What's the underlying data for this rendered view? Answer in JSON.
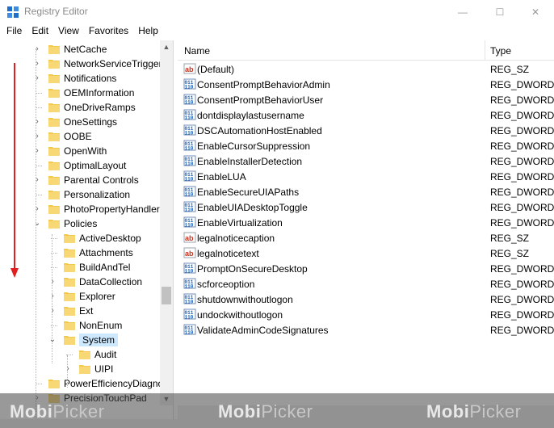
{
  "window": {
    "title": "Registry Editor",
    "min_glyph": "—",
    "max_glyph": "☐",
    "close_glyph": "✕"
  },
  "menu": [
    "File",
    "Edit",
    "View",
    "Favorites",
    "Help"
  ],
  "tree": {
    "items": [
      {
        "label": "NetCache",
        "expandable": true,
        "expanded": false
      },
      {
        "label": "NetworkServiceTriggers",
        "expandable": true,
        "expanded": false
      },
      {
        "label": "Notifications",
        "expandable": true,
        "expanded": false
      },
      {
        "label": "OEMInformation",
        "expandable": false,
        "expanded": false
      },
      {
        "label": "OneDriveRamps",
        "expandable": false,
        "expanded": false
      },
      {
        "label": "OneSettings",
        "expandable": true,
        "expanded": false
      },
      {
        "label": "OOBE",
        "expandable": true,
        "expanded": false
      },
      {
        "label": "OpenWith",
        "expandable": true,
        "expanded": false
      },
      {
        "label": "OptimalLayout",
        "expandable": false,
        "expanded": false
      },
      {
        "label": "Parental Controls",
        "expandable": true,
        "expanded": false
      },
      {
        "label": "Personalization",
        "expandable": false,
        "expanded": false
      },
      {
        "label": "PhotoPropertyHandler",
        "expandable": true,
        "expanded": false
      },
      {
        "label": "Policies",
        "expandable": true,
        "expanded": true
      },
      {
        "label": "ActiveDesktop",
        "expandable": false,
        "expanded": false
      },
      {
        "label": "Attachments",
        "expandable": false,
        "expanded": false
      },
      {
        "label": "BuildAndTel",
        "expandable": false,
        "expanded": false
      },
      {
        "label": "DataCollection",
        "expandable": true,
        "expanded": false
      },
      {
        "label": "Explorer",
        "expandable": true,
        "expanded": false
      },
      {
        "label": "Ext",
        "expandable": true,
        "expanded": false
      },
      {
        "label": "NonEnum",
        "expandable": false,
        "expanded": false
      },
      {
        "label": "System",
        "expandable": true,
        "expanded": true,
        "selected": true
      },
      {
        "label": "Audit",
        "expandable": false,
        "expanded": false
      },
      {
        "label": "UIPI",
        "expandable": true,
        "expanded": false
      },
      {
        "label": "PowerEfficiencyDiagnostics",
        "expandable": false,
        "expanded": false
      },
      {
        "label": "PrecisionTouchPad",
        "expandable": true,
        "expanded": false
      }
    ]
  },
  "list": {
    "columns": {
      "name": "Name",
      "type": "Type"
    },
    "rows": [
      {
        "name": "(Default)",
        "type": "REG_SZ",
        "icon": "string-value-icon"
      },
      {
        "name": "ConsentPromptBehaviorAdmin",
        "type": "REG_DWORD",
        "icon": "binary-value-icon"
      },
      {
        "name": "ConsentPromptBehaviorUser",
        "type": "REG_DWORD",
        "icon": "binary-value-icon"
      },
      {
        "name": "dontdisplaylastusername",
        "type": "REG_DWORD",
        "icon": "binary-value-icon"
      },
      {
        "name": "DSCAutomationHostEnabled",
        "type": "REG_DWORD",
        "icon": "binary-value-icon"
      },
      {
        "name": "EnableCursorSuppression",
        "type": "REG_DWORD",
        "icon": "binary-value-icon"
      },
      {
        "name": "EnableInstallerDetection",
        "type": "REG_DWORD",
        "icon": "binary-value-icon"
      },
      {
        "name": "EnableLUA",
        "type": "REG_DWORD",
        "icon": "binary-value-icon"
      },
      {
        "name": "EnableSecureUIAPaths",
        "type": "REG_DWORD",
        "icon": "binary-value-icon"
      },
      {
        "name": "EnableUIADesktopToggle",
        "type": "REG_DWORD",
        "icon": "binary-value-icon"
      },
      {
        "name": "EnableVirtualization",
        "type": "REG_DWORD",
        "icon": "binary-value-icon"
      },
      {
        "name": "legalnoticecaption",
        "type": "REG_SZ",
        "icon": "string-value-icon"
      },
      {
        "name": "legalnoticetext",
        "type": "REG_SZ",
        "icon": "string-value-icon"
      },
      {
        "name": "PromptOnSecureDesktop",
        "type": "REG_DWORD",
        "icon": "binary-value-icon"
      },
      {
        "name": "scforceoption",
        "type": "REG_DWORD",
        "icon": "binary-value-icon"
      },
      {
        "name": "shutdownwithoutlogon",
        "type": "REG_DWORD",
        "icon": "binary-value-icon"
      },
      {
        "name": "undockwithoutlogon",
        "type": "REG_DWORD",
        "icon": "binary-value-icon"
      },
      {
        "name": "ValidateAdminCodeSignatures",
        "type": "REG_DWORD",
        "icon": "binary-value-icon"
      }
    ]
  },
  "watermark": {
    "brand_a": "Mobi",
    "brand_b": "Picker"
  },
  "colors": {
    "folder": "#f2c94c",
    "selection": "#cce8ff",
    "arrow": "#e0201e",
    "watermark_band": "#464646"
  }
}
